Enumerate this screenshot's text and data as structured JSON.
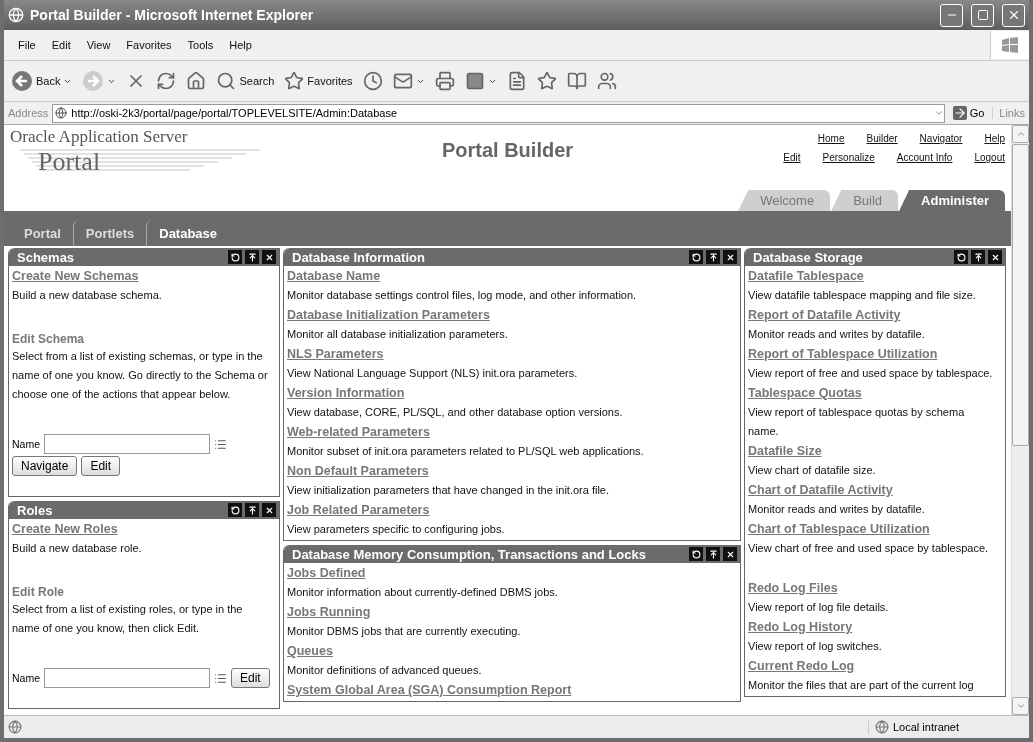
{
  "window": {
    "title": "Portal Builder - Microsoft Internet Explorer"
  },
  "menu": [
    "File",
    "Edit",
    "View",
    "Favorites",
    "Tools",
    "Help"
  ],
  "toolbar": [
    {
      "kind": "back",
      "label": "Back",
      "dropdown": true
    },
    {
      "kind": "forward",
      "dropdown": true
    },
    {
      "kind": "stop"
    },
    {
      "kind": "refresh"
    },
    {
      "kind": "home"
    },
    {
      "kind": "search",
      "label": "Search"
    },
    {
      "kind": "favorites",
      "label": "Favorites"
    },
    {
      "kind": "history"
    },
    {
      "kind": "mail",
      "dropdown": true
    },
    {
      "kind": "print"
    },
    {
      "kind": "edit",
      "dropdown": true
    },
    {
      "kind": "discuss"
    },
    {
      "kind": "research"
    },
    {
      "kind": "library"
    },
    {
      "kind": "messenger"
    }
  ],
  "address": {
    "label": "Address",
    "url": "http://oski-2k3/portal/page/portal/TOPLEVELSITE/Admin:Database",
    "go": "Go",
    "links": "Links"
  },
  "portal": {
    "logo_line1": "Oracle Application Server",
    "logo_line2": "Portal",
    "title": "Portal Builder",
    "global_links": [
      "Home",
      "Builder",
      "Navigator",
      "Help"
    ],
    "user_links": [
      "Edit",
      "Personalize",
      "Account Info",
      "Logout"
    ],
    "main_tabs": [
      {
        "label": "Welcome",
        "selected": false
      },
      {
        "label": "Build",
        "selected": false
      },
      {
        "label": "Administer",
        "selected": true
      }
    ],
    "sub_tabs": [
      {
        "label": "Portal",
        "selected": false
      },
      {
        "label": "Portlets",
        "selected": false
      },
      {
        "label": "Database",
        "selected": true
      }
    ]
  },
  "columns": [
    [
      {
        "title": "Schemas",
        "items": [
          {
            "kind": "link",
            "text": "Create New Schemas"
          },
          {
            "kind": "desc",
            "text": "Build a new database schema."
          },
          {
            "kind": "heading",
            "text": "Edit Schema"
          },
          {
            "kind": "desc",
            "text": "Select from a list of existing schemas, or type in the name of one you know. Go directly to the Schema or choose one of the actions that appear below."
          }
        ],
        "form": {
          "label": "Name",
          "buttons": [
            "Navigate",
            "Edit"
          ]
        }
      },
      {
        "title": "Roles",
        "items": [
          {
            "kind": "link",
            "text": "Create New Roles"
          },
          {
            "kind": "desc",
            "text": "Build a new database role."
          },
          {
            "kind": "heading",
            "text": "Edit Role"
          },
          {
            "kind": "desc",
            "text": "Select from a list of existing roles, or type in the name of one you know, then click Edit."
          }
        ],
        "form": {
          "label": "Name",
          "buttons": [
            "Edit"
          ]
        }
      }
    ],
    [
      {
        "title": "Database Information",
        "items": [
          {
            "kind": "link",
            "text": "Database Name"
          },
          {
            "kind": "desc",
            "text": "Monitor database settings control files, log mode, and other information."
          },
          {
            "kind": "link",
            "text": "Database Initialization Parameters"
          },
          {
            "kind": "desc",
            "text": "Monitor all database initialization parameters."
          },
          {
            "kind": "link",
            "text": "NLS Parameters"
          },
          {
            "kind": "desc",
            "text": "View National Language Support (NLS) init.ora parameters."
          },
          {
            "kind": "link",
            "text": "Version Information"
          },
          {
            "kind": "desc",
            "text": "View database, CORE, PL/SQL, and other database option versions."
          },
          {
            "kind": "link",
            "text": "Web-related Parameters"
          },
          {
            "kind": "desc",
            "text": "Monitor subset of init.ora parameters related to PL/SQL web applications."
          },
          {
            "kind": "link",
            "text": "Non Default Parameters"
          },
          {
            "kind": "desc",
            "text": "View initialization parameters that have changed in the init.ora file."
          },
          {
            "kind": "link",
            "text": "Job Related Parameters"
          },
          {
            "kind": "desc",
            "text": "View parameters specific to configuring jobs."
          }
        ]
      },
      {
        "title": "Database Memory Consumption, Transactions and Locks",
        "items": [
          {
            "kind": "link",
            "text": "Jobs Defined"
          },
          {
            "kind": "desc",
            "text": "Monitor information about currently-defined DBMS jobs."
          },
          {
            "kind": "link",
            "text": "Jobs Running"
          },
          {
            "kind": "desc",
            "text": "Monitor DBMS jobs that are currently executing."
          },
          {
            "kind": "link",
            "text": "Queues"
          },
          {
            "kind": "desc",
            "text": "Monitor definitions of advanced queues."
          },
          {
            "kind": "link",
            "text": "System Global Area (SGA) Consumption Report"
          }
        ]
      }
    ],
    [
      {
        "title": "Database Storage",
        "items": [
          {
            "kind": "link",
            "text": "Datafile Tablespace"
          },
          {
            "kind": "desc",
            "text": "View datafile tablespace mapping and file size."
          },
          {
            "kind": "link",
            "text": "Report of Datafile Activity"
          },
          {
            "kind": "desc",
            "text": "Monitor reads and writes by datafile."
          },
          {
            "kind": "link",
            "text": "Report of Tablespace Utilization"
          },
          {
            "kind": "desc",
            "text": "View report of free and used space by tablespace."
          },
          {
            "kind": "link",
            "text": "Tablespace Quotas"
          },
          {
            "kind": "desc",
            "text": "View report of tablespace quotas by schema name."
          },
          {
            "kind": "link",
            "text": "Datafile Size"
          },
          {
            "kind": "desc",
            "text": "View chart of datafile size."
          },
          {
            "kind": "link",
            "text": "Chart of Datafile Activity"
          },
          {
            "kind": "desc",
            "text": "Monitor reads and writes by datafile."
          },
          {
            "kind": "link",
            "text": "Chart of Tablespace Utilization"
          },
          {
            "kind": "desc",
            "text": "View chart of free and used space by tablespace."
          },
          {
            "kind": "link",
            "text": "Redo Log Files",
            "gap_before": true
          },
          {
            "kind": "desc",
            "text": "View report of log file details."
          },
          {
            "kind": "link",
            "text": "Redo Log History"
          },
          {
            "kind": "desc",
            "text": "View report of log switches."
          },
          {
            "kind": "link",
            "text": "Current Redo Log"
          },
          {
            "kind": "desc",
            "text": "Monitor the files that are part of the current log"
          }
        ]
      }
    ]
  ],
  "status_bar": {
    "zone": "Local intranet"
  }
}
